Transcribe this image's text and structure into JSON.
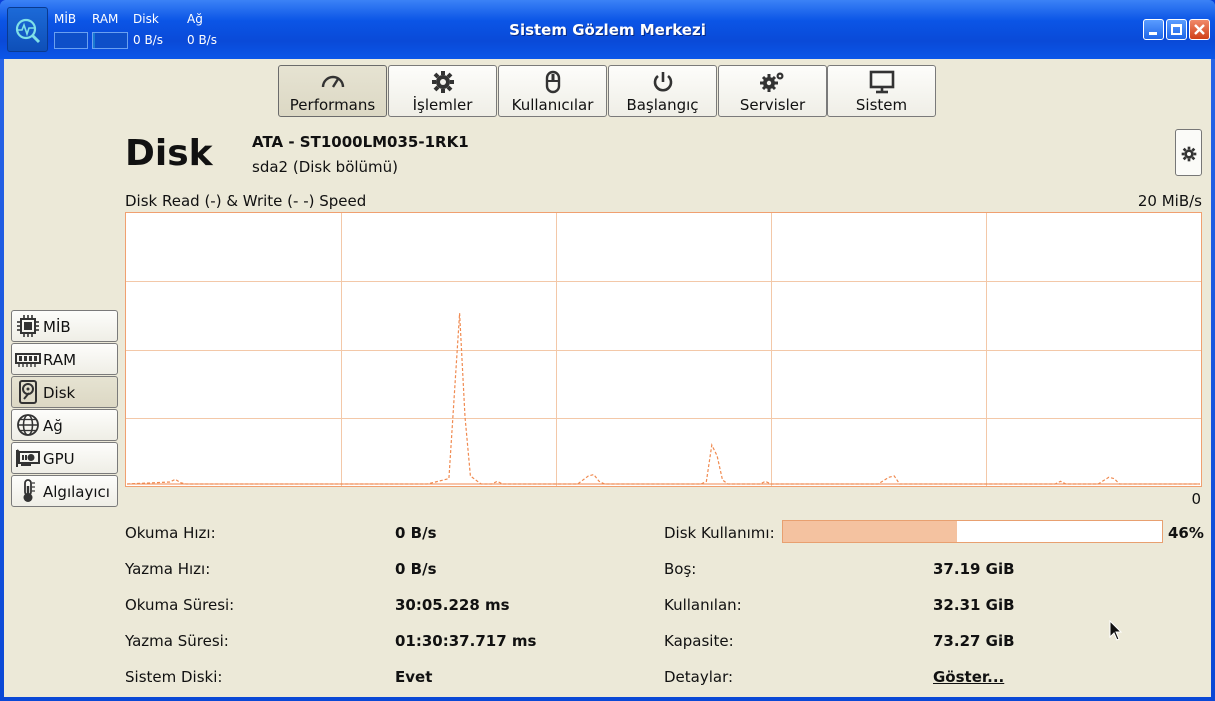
{
  "window": {
    "title": "Sistem Gözlem Merkezi",
    "mini_monitors": [
      {
        "label": "MİB",
        "fill": 0.0
      },
      {
        "label": "RAM",
        "fill": 0.05
      },
      {
        "label": "Disk",
        "value": "0 B/s"
      },
      {
        "label": "Ağ",
        "value": "0 B/s"
      }
    ]
  },
  "tabs": [
    {
      "label": "Performans",
      "icon": "speedometer-icon",
      "active": true
    },
    {
      "label": "İşlemler",
      "icon": "gear-icon"
    },
    {
      "label": "Kullanıcılar",
      "icon": "mouse-icon"
    },
    {
      "label": "Başlangıç",
      "icon": "power-icon"
    },
    {
      "label": "Servisler",
      "icon": "gears-icon"
    },
    {
      "label": "Sistem",
      "icon": "monitor-icon"
    }
  ],
  "header": {
    "title": "Disk",
    "model": "ATA - ST1000LM035-1RK1",
    "partition": "sda2 (Disk bölümü)"
  },
  "sidebar": [
    {
      "label": "MİB",
      "icon": "cpu-icon"
    },
    {
      "label": "RAM",
      "icon": "ram-icon"
    },
    {
      "label": "Disk",
      "icon": "disk-icon",
      "active": true
    },
    {
      "label": "Ağ",
      "icon": "globe-icon"
    },
    {
      "label": "GPU",
      "icon": "gpu-icon"
    },
    {
      "label": "Algılayıcı",
      "icon": "thermometer-icon"
    }
  ],
  "chart_data": {
    "type": "line",
    "title": "Disk Read (-) & Write (- -) Speed",
    "ymax_label": "20 MiB/s",
    "ymin_label": "0",
    "ylim": [
      0,
      20
    ],
    "grid": true,
    "series": [
      {
        "values": [
          0,
          0,
          0,
          0,
          0,
          0,
          0,
          0.2,
          0,
          0,
          0,
          0,
          0,
          0,
          0,
          0,
          0,
          0,
          0,
          0,
          0,
          0,
          0,
          0,
          0,
          0,
          0,
          0,
          0,
          0,
          0,
          0,
          0,
          0,
          0,
          0,
          0,
          0,
          0,
          0,
          0,
          0,
          0,
          0,
          0,
          0,
          0,
          0,
          0,
          0,
          0,
          0,
          0,
          0,
          0,
          0,
          0,
          0,
          0,
          0,
          0,
          0,
          0,
          0,
          0,
          0,
          0,
          0,
          0,
          0,
          0,
          0,
          0,
          0,
          0,
          0,
          0,
          0,
          0,
          0,
          0,
          0,
          0,
          0,
          0,
          0,
          0,
          0,
          0,
          0,
          0,
          0,
          0,
          0,
          0,
          0,
          0,
          0,
          0,
          0,
          0,
          0,
          0,
          0,
          0,
          0,
          0,
          0,
          0,
          0,
          0,
          0,
          0,
          0,
          0,
          0,
          0,
          0,
          0,
          0,
          0,
          0,
          0,
          0,
          0,
          0,
          0,
          0,
          0,
          0,
          0,
          0,
          0,
          0,
          0,
          0,
          0,
          0,
          0,
          0,
          0,
          0,
          0,
          0,
          0,
          0,
          0,
          0,
          0,
          0,
          0,
          0,
          0,
          0,
          0,
          0,
          0,
          0,
          0,
          0,
          0,
          0,
          0,
          0,
          0,
          0,
          0,
          0,
          0,
          0,
          0,
          0,
          0,
          0,
          0,
          0,
          0,
          0,
          0,
          0,
          0,
          0,
          0,
          0,
          0,
          0,
          0,
          0,
          0,
          0,
          0,
          0,
          0,
          0,
          0,
          0,
          0,
          0,
          0,
          0,
          0,
          0,
          0,
          0,
          0,
          0,
          0,
          0,
          0,
          0,
          0,
          0,
          0,
          0,
          0,
          0,
          0,
          0,
          0,
          0,
          0,
          0,
          0,
          0,
          0,
          0,
          0,
          0,
          0,
          0,
          0,
          0,
          0,
          0,
          0,
          0,
          0,
          0,
          0,
          0,
          0,
          0,
          0,
          0,
          0,
          0,
          0,
          0,
          0,
          0,
          0,
          0,
          0,
          0,
          0,
          0,
          0,
          0,
          0,
          0,
          0,
          0,
          0,
          0,
          0,
          0,
          0,
          0,
          0,
          0,
          0,
          0,
          0,
          0,
          0,
          0,
          0,
          0,
          0,
          0,
          0
        ]
      },
      {
        "values": [
          0,
          0,
          0,
          0,
          0,
          0,
          0.1,
          0.4,
          0.1,
          0,
          0,
          0,
          0,
          0,
          0,
          0,
          0,
          0,
          0,
          0,
          0,
          0,
          0,
          0,
          0,
          0,
          0,
          0,
          0,
          0,
          0,
          0,
          0,
          0,
          0,
          0,
          0,
          0,
          0,
          0,
          0,
          0,
          0,
          0,
          0,
          0,
          0,
          0,
          0,
          0,
          0,
          0,
          0,
          0,
          0,
          0,
          0,
          0,
          0,
          0,
          0,
          0,
          0,
          0,
          0,
          0,
          0,
          0,
          0,
          0,
          0,
          0,
          0,
          0,
          0,
          0,
          0,
          0,
          0,
          0,
          0,
          0,
          0,
          0,
          0,
          0,
          0,
          0,
          0,
          0,
          0,
          0,
          0,
          0,
          0,
          0,
          0,
          0,
          0,
          0,
          0,
          0,
          0,
          0,
          0,
          0,
          0,
          0,
          0,
          0,
          0,
          0,
          0,
          0,
          0,
          0,
          0,
          0,
          0,
          0,
          0,
          0,
          0,
          0,
          0,
          0,
          0,
          0,
          0,
          0,
          0,
          0,
          0,
          0,
          0,
          0,
          0,
          0,
          0,
          0,
          0,
          0,
          0,
          0,
          0,
          0,
          0,
          0,
          0,
          0,
          0,
          0,
          0,
          0,
          0,
          0,
          0,
          0,
          0,
          0,
          0,
          0,
          0,
          0,
          0,
          0,
          0,
          0,
          0,
          0,
          0,
          0,
          0,
          0,
          0,
          0,
          0,
          0,
          0,
          0,
          0,
          0,
          0,
          0,
          0,
          0,
          0,
          0,
          0,
          0,
          0,
          0,
          0,
          0,
          0,
          0,
          0,
          0,
          0,
          0,
          0,
          0,
          0,
          0,
          0,
          0,
          0,
          0,
          0,
          0,
          0,
          0,
          0,
          0,
          0,
          0,
          0,
          0,
          0,
          0,
          0,
          0,
          0,
          0,
          0,
          0,
          0,
          0,
          0,
          0,
          0,
          0,
          0,
          0,
          0,
          0,
          0,
          0,
          0,
          0,
          0,
          0,
          0,
          0,
          0,
          0,
          0,
          0,
          0,
          0,
          0,
          0,
          0,
          0,
          0,
          0,
          0,
          0,
          0,
          0,
          0,
          0,
          0,
          0,
          0,
          0,
          0,
          0,
          0,
          0,
          0,
          0,
          0,
          0,
          0,
          0,
          0,
          0,
          0
        ]
      }
    ],
    "points": [
      [
        0,
        0
      ],
      [
        8,
        0.15
      ],
      [
        9,
        0.35
      ],
      [
        10,
        0.1
      ],
      [
        11,
        0
      ],
      [
        56,
        0
      ],
      [
        60,
        0.4
      ],
      [
        62,
        12.7
      ],
      [
        63,
        5
      ],
      [
        64,
        0.6
      ],
      [
        65,
        0.3
      ],
      [
        66,
        0
      ],
      [
        68,
        0
      ],
      [
        69,
        0.2
      ],
      [
        70,
        0
      ],
      [
        84,
        0
      ],
      [
        86,
        0.6
      ],
      [
        87,
        0.7
      ],
      [
        88,
        0.2
      ],
      [
        89,
        0
      ],
      [
        107,
        0
      ],
      [
        108,
        0.2
      ],
      [
        109,
        2.9
      ],
      [
        110,
        2.1
      ],
      [
        111,
        0.3
      ],
      [
        112,
        0
      ],
      [
        118,
        0
      ],
      [
        119,
        0.2
      ],
      [
        120,
        0
      ],
      [
        140,
        0
      ],
      [
        142,
        0.5
      ],
      [
        143,
        0.6
      ],
      [
        144,
        0
      ],
      [
        173,
        0
      ],
      [
        174,
        0.2
      ],
      [
        175,
        0
      ],
      [
        181,
        0
      ],
      [
        183,
        0.5
      ],
      [
        184,
        0.4
      ],
      [
        185,
        0
      ],
      [
        200,
        0
      ]
    ]
  },
  "stats_left": [
    {
      "label": "Okuma Hızı:",
      "value": "0 B/s"
    },
    {
      "label": "Yazma Hızı:",
      "value": "0 B/s"
    },
    {
      "label": "Okuma Süresi:",
      "value": "30:05.228 ms"
    },
    {
      "label": "Yazma Süresi:",
      "value": "01:30:37.717 ms"
    },
    {
      "label": "Sistem Diski:",
      "value": "Evet"
    }
  ],
  "stats_right": {
    "usage_label": "Disk Kullanımı:",
    "usage_percent": 46,
    "usage_text": "46%",
    "rows": [
      {
        "label": "Boş:",
        "value": "37.19 GiB"
      },
      {
        "label": "Kullanılan:",
        "value": "32.31 GiB"
      },
      {
        "label": "Kapasite:",
        "value": "73.27 GiB"
      },
      {
        "label": "Detaylar:",
        "value": "Göster..."
      }
    ]
  },
  "colors": {
    "accent": "#f08a50",
    "grid": "#f3c8a8",
    "usage_fill": "#f4c2a0"
  }
}
